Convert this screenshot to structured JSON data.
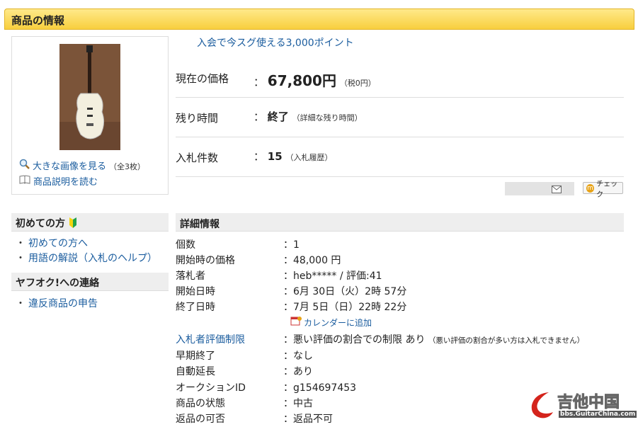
{
  "header": {
    "title": "商品の情報"
  },
  "image_panel": {
    "large_image_link": "大きな画像を見る",
    "image_count": "（全3枚）",
    "description_link": "商品説明を読む"
  },
  "promo": "入会で今スグ使える3,000ポイント",
  "price": {
    "label": "現在の価格",
    "sep": "：",
    "value": "67,800円",
    "tax": "（税0円）"
  },
  "time": {
    "label": "残り時間",
    "sep": "：",
    "value": "終了",
    "link": "（詳細な残り時間）"
  },
  "bids": {
    "label": "入札件数",
    "sep": "：",
    "value": "15",
    "link": "（入札履歴）"
  },
  "check_button": {
    "icon_letter": "m",
    "label": "チェック"
  },
  "sidebar": {
    "beginner": {
      "title": "初めての方",
      "items": [
        "初めての方へ",
        "用語の解説（入札のヘルプ）"
      ]
    },
    "contact": {
      "title": "ヤフオク!への連絡",
      "items": [
        "違反商品の申告"
      ]
    }
  },
  "details": {
    "title": "詳細情報",
    "rows": [
      {
        "k": "個数",
        "v": "：1"
      },
      {
        "k": "開始時の価格",
        "v": "：48,000 円"
      },
      {
        "k": "落札者",
        "v": "：heb***** / 評価:41"
      },
      {
        "k": "開始日時",
        "v": "：6月 30日（火）2時 57分"
      },
      {
        "k": "終了日時",
        "v": "：7月 5日（日）22時 22分"
      }
    ],
    "calendar_link": "カレンダーに追加",
    "restriction": {
      "k": "入札者評価制限",
      "v": "：悪い評価の割合での制限 あり",
      "note": "（悪い評価の割合が多い方は入札できません）"
    },
    "rows2": [
      {
        "k": "早期終了",
        "v": "：なし"
      },
      {
        "k": "自動延長",
        "v": "：あり"
      },
      {
        "k": "オークションID",
        "v": "：g154697453"
      },
      {
        "k": "商品の状態",
        "v": "：中古"
      },
      {
        "k": "返品の可否",
        "v": "：返品不可"
      }
    ]
  },
  "watermark": {
    "main": "吉他中国",
    "sub": "bbs.GuitarChina.com"
  }
}
